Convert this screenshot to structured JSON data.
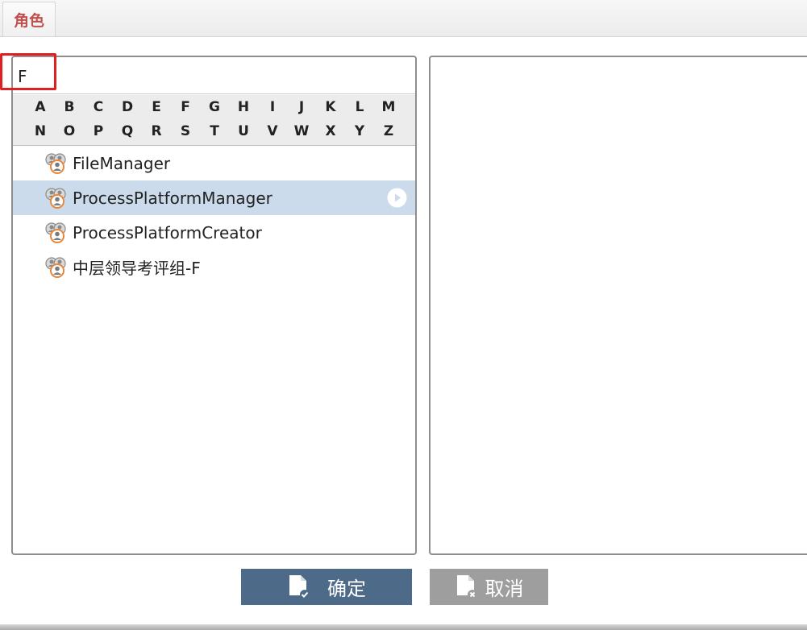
{
  "tab": {
    "label": "角色"
  },
  "search": {
    "value": "F"
  },
  "alphabet": {
    "row1": [
      "A",
      "B",
      "C",
      "D",
      "E",
      "F",
      "G",
      "H",
      "I",
      "J",
      "K",
      "L",
      "M"
    ],
    "row2": [
      "N",
      "O",
      "P",
      "Q",
      "R",
      "S",
      "T",
      "U",
      "V",
      "W",
      "X",
      "Y",
      "Z"
    ]
  },
  "roles": [
    {
      "label": "FileManager",
      "selected": false
    },
    {
      "label": "ProcessPlatformManager",
      "selected": true
    },
    {
      "label": "ProcessPlatformCreator",
      "selected": false
    },
    {
      "label": "中层领导考评组-F",
      "selected": false
    }
  ],
  "buttons": {
    "ok_label": "确定",
    "cancel_label": "取消"
  },
  "icons": {
    "role": "role-group-icon",
    "select": "play-circle-icon",
    "ok": "document-check-icon",
    "cancel": "document-cancel-icon"
  },
  "colors": {
    "tab_text": "#c0504d",
    "selection": "#cbdbeb",
    "ok_button": "#4e6a89",
    "cancel_button": "#9e9e9e",
    "highlight": "#e02020"
  }
}
